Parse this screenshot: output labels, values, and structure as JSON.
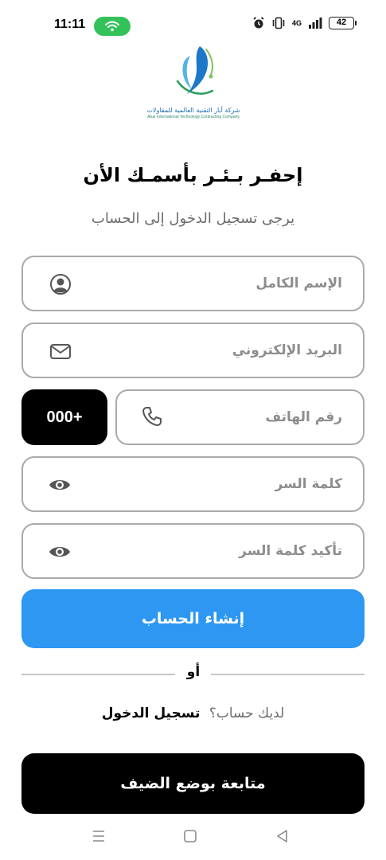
{
  "status_bar": {
    "time": "11:11",
    "battery": "42",
    "network": "4G"
  },
  "logo": {
    "name_ar": "شركة أبار التقنية العالمية للمقاولات",
    "name_en": "Abar International Technology Contracting Company"
  },
  "title": "إحفـر بـئـر بأسمـك الأن",
  "subtitle": "يرجى تسجيل الدخول إلى الحساب",
  "form": {
    "full_name": {
      "placeholder": "الإسم الكامل",
      "icon": "person-icon"
    },
    "email": {
      "placeholder": "البريد الإلكتروني",
      "icon": "mail-icon"
    },
    "phone": {
      "placeholder": "رقم الهاتف",
      "icon": "phone-icon",
      "country_code": "000+"
    },
    "password": {
      "placeholder": "كلمة السر",
      "icon": "eye-icon"
    },
    "confirm_password": {
      "placeholder": "تأكيد كلمة السر",
      "icon": "eye-icon"
    }
  },
  "buttons": {
    "create_account": "إنشاء الحساب",
    "guest": "متابعة بوضع الضيف"
  },
  "separator": "أو",
  "login": {
    "question": "لديك حساب؟",
    "link": "تسجيل الدخول"
  },
  "colors": {
    "primary": "#2d97f2",
    "wifi_pill": "#33c25a",
    "dark_button": "#000000",
    "field_border": "#aaaaaa"
  }
}
